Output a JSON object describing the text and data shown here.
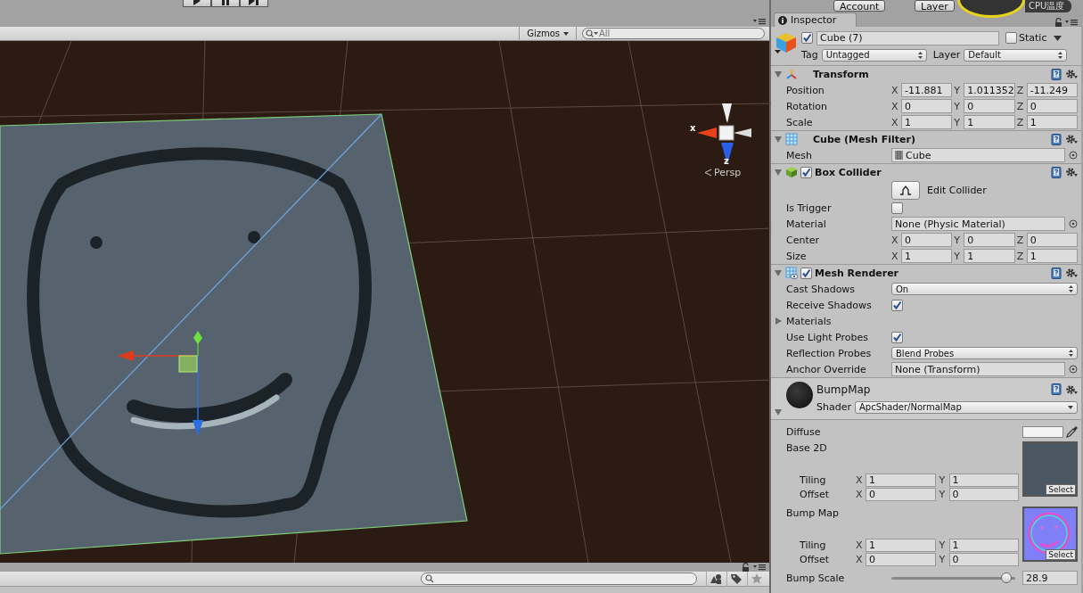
{
  "toolbar": {
    "account": "Account",
    "layers": "Layer"
  },
  "overlay": {
    "label": "CPU温度"
  },
  "scene": {
    "gizmos": "Gizmos",
    "search": {
      "placeholder": "All"
    },
    "orientation": {
      "x_label": "x",
      "z_label": "z",
      "projection": "Persp"
    }
  },
  "inspector": {
    "tab": {
      "label": "Inspector",
      "selected": true
    },
    "object": {
      "active": true,
      "name": "Cube (7)",
      "static_label": "Static",
      "static": false,
      "tag_label": "Tag",
      "tag": "Untagged",
      "layer_label": "Layer",
      "layer": "Default"
    },
    "components": [
      {
        "kind": "transform",
        "title": "Transform",
        "expanded": true,
        "rows": [
          {
            "kind": "vector3",
            "label": "Position",
            "fields": [
              {
                "axis": "X",
                "value": "-11.881"
              },
              {
                "axis": "Y",
                "value": "1.011352"
              },
              {
                "axis": "Z",
                "value": "-11.249"
              }
            ]
          },
          {
            "kind": "vector3",
            "label": "Rotation",
            "fields": [
              {
                "axis": "X",
                "value": "0"
              },
              {
                "axis": "Y",
                "value": "0"
              },
              {
                "axis": "Z",
                "value": "0"
              }
            ]
          },
          {
            "kind": "vector3",
            "label": "Scale",
            "fields": [
              {
                "axis": "X",
                "value": "1"
              },
              {
                "axis": "Y",
                "value": "1"
              },
              {
                "axis": "Z",
                "value": "1"
              }
            ]
          }
        ]
      },
      {
        "kind": "mesh_filter",
        "title": "Cube (Mesh Filter)",
        "expanded": true,
        "rows": [
          {
            "kind": "asset",
            "label": "Mesh",
            "value": "Cube"
          }
        ]
      },
      {
        "kind": "box_collider",
        "title": "Box Collider",
        "expanded": true,
        "enabled": true,
        "rows": [
          {
            "kind": "button",
            "label": "Edit Collider"
          },
          {
            "kind": "checkbox",
            "label": "Is Trigger",
            "checked": false
          },
          {
            "kind": "object",
            "label": "Material",
            "value": "None (Physic Material)"
          },
          {
            "kind": "vector3",
            "label": "Center",
            "fields": [
              {
                "axis": "X",
                "value": "0"
              },
              {
                "axis": "Y",
                "value": "0"
              },
              {
                "axis": "Z",
                "value": "0"
              }
            ]
          },
          {
            "kind": "vector3",
            "label": "Size",
            "fields": [
              {
                "axis": "X",
                "value": "1"
              },
              {
                "axis": "Y",
                "value": "1"
              },
              {
                "axis": "Z",
                "value": "1"
              }
            ]
          }
        ]
      },
      {
        "kind": "mesh_renderer",
        "title": "Mesh Renderer",
        "expanded": true,
        "enabled": true,
        "rows": [
          {
            "kind": "dropdown",
            "label": "Cast Shadows",
            "value": "On"
          },
          {
            "kind": "checkbox",
            "label": "Receive Shadows",
            "checked": true
          },
          {
            "kind": "foldout",
            "label": "Materials",
            "expanded": false
          },
          {
            "kind": "checkbox",
            "label": "Use Light Probes",
            "checked": true
          },
          {
            "kind": "dropdown",
            "label": "Reflection Probes",
            "value": "Blend Probes"
          },
          {
            "kind": "object",
            "label": "Anchor Override",
            "value": "None (Transform)"
          }
        ]
      }
    ],
    "material": {
      "name": "BumpMap",
      "shader_label": "Shader",
      "shader": "ApcShader/NormalMap",
      "properties": [
        {
          "kind": "color",
          "label": "Diffuse"
        },
        {
          "kind": "texture",
          "label": "Base 2D",
          "select": "Select",
          "tiling_label": "Tiling",
          "offset_label": "Offset",
          "tiling": [
            {
              "axis": "X",
              "value": "1"
            },
            {
              "axis": "Y",
              "value": "1"
            }
          ],
          "offset": [
            {
              "axis": "X",
              "value": "0"
            },
            {
              "axis": "Y",
              "value": "0"
            }
          ]
        },
        {
          "kind": "normal_map",
          "label": "Bump Map",
          "select": "Select",
          "tiling_label": "Tiling",
          "offset_label": "Offset",
          "tiling": [
            {
              "axis": "X",
              "value": "1"
            },
            {
              "axis": "Y",
              "value": "1"
            }
          ],
          "offset": [
            {
              "axis": "X",
              "value": "0"
            },
            {
              "axis": "Y",
              "value": "0"
            }
          ]
        },
        {
          "kind": "slider",
          "label": "Bump Scale",
          "level": 0.93,
          "value": "28.9"
        }
      ]
    }
  }
}
